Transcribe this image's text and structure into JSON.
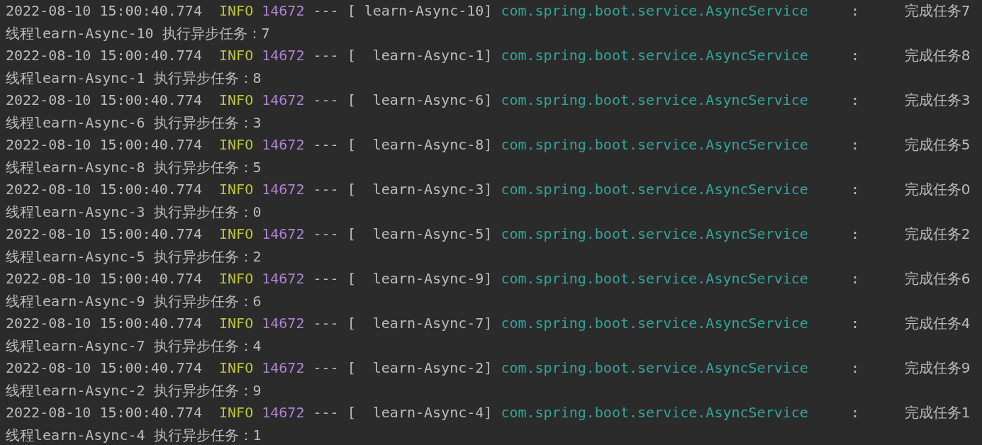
{
  "console": {
    "lines": [
      {
        "kind": "log",
        "timestamp": "2022-08-10 15:00:40.774",
        "level": "INFO",
        "pid": "14672",
        "separator": "---",
        "thread": "[ learn-Async-10]",
        "logger": "com.spring.boot.service.AsyncService",
        "colon": ":",
        "message": "完成任务7"
      },
      {
        "kind": "output",
        "text": "线程learn-Async-10 执行异步任务：7"
      },
      {
        "kind": "log",
        "timestamp": "2022-08-10 15:00:40.774",
        "level": "INFO",
        "pid": "14672",
        "separator": "---",
        "thread": "[  learn-Async-1]",
        "logger": "com.spring.boot.service.AsyncService",
        "colon": ":",
        "message": "完成任务8"
      },
      {
        "kind": "output",
        "text": "线程learn-Async-1 执行异步任务：8"
      },
      {
        "kind": "log",
        "timestamp": "2022-08-10 15:00:40.774",
        "level": "INFO",
        "pid": "14672",
        "separator": "---",
        "thread": "[  learn-Async-6]",
        "logger": "com.spring.boot.service.AsyncService",
        "colon": ":",
        "message": "完成任务3"
      },
      {
        "kind": "output",
        "text": "线程learn-Async-6 执行异步任务：3"
      },
      {
        "kind": "log",
        "timestamp": "2022-08-10 15:00:40.774",
        "level": "INFO",
        "pid": "14672",
        "separator": "---",
        "thread": "[  learn-Async-8]",
        "logger": "com.spring.boot.service.AsyncService",
        "colon": ":",
        "message": "完成任务5"
      },
      {
        "kind": "output",
        "text": "线程learn-Async-8 执行异步任务：5"
      },
      {
        "kind": "log",
        "timestamp": "2022-08-10 15:00:40.774",
        "level": "INFO",
        "pid": "14672",
        "separator": "---",
        "thread": "[  learn-Async-3]",
        "logger": "com.spring.boot.service.AsyncService",
        "colon": ":",
        "message": "完成任务0"
      },
      {
        "kind": "output",
        "text": "线程learn-Async-3 执行异步任务：0"
      },
      {
        "kind": "log",
        "timestamp": "2022-08-10 15:00:40.774",
        "level": "INFO",
        "pid": "14672",
        "separator": "---",
        "thread": "[  learn-Async-5]",
        "logger": "com.spring.boot.service.AsyncService",
        "colon": ":",
        "message": "完成任务2"
      },
      {
        "kind": "output",
        "text": "线程learn-Async-5 执行异步任务：2"
      },
      {
        "kind": "log",
        "timestamp": "2022-08-10 15:00:40.774",
        "level": "INFO",
        "pid": "14672",
        "separator": "---",
        "thread": "[  learn-Async-9]",
        "logger": "com.spring.boot.service.AsyncService",
        "colon": ":",
        "message": "完成任务6"
      },
      {
        "kind": "output",
        "text": "线程learn-Async-9 执行异步任务：6"
      },
      {
        "kind": "log",
        "timestamp": "2022-08-10 15:00:40.774",
        "level": "INFO",
        "pid": "14672",
        "separator": "---",
        "thread": "[  learn-Async-7]",
        "logger": "com.spring.boot.service.AsyncService",
        "colon": ":",
        "message": "完成任务4"
      },
      {
        "kind": "output",
        "text": "线程learn-Async-7 执行异步任务：4"
      },
      {
        "kind": "log",
        "timestamp": "2022-08-10 15:00:40.774",
        "level": "INFO",
        "pid": "14672",
        "separator": "---",
        "thread": "[  learn-Async-2]",
        "logger": "com.spring.boot.service.AsyncService",
        "colon": ":",
        "message": "完成任务9"
      },
      {
        "kind": "output",
        "text": "线程learn-Async-2 执行异步任务：9"
      },
      {
        "kind": "log",
        "timestamp": "2022-08-10 15:00:40.774",
        "level": "INFO",
        "pid": "14672",
        "separator": "---",
        "thread": "[  learn-Async-4]",
        "logger": "com.spring.boot.service.AsyncService",
        "colon": ":",
        "message": "完成任务1"
      },
      {
        "kind": "output",
        "text": "线程learn-Async-4 执行异步任务：1"
      }
    ]
  }
}
